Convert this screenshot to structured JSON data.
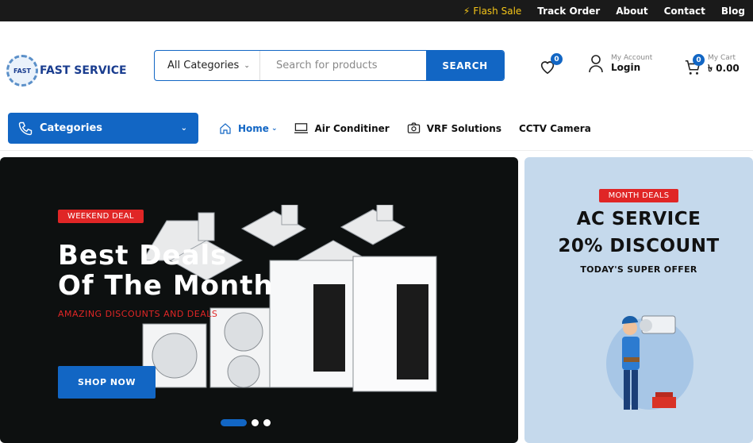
{
  "topbar": {
    "flash_sale": "Flash Sale",
    "track_order": "Track Order",
    "about": "About",
    "contact": "Contact",
    "blog": "Blog"
  },
  "logo": {
    "badge": "FAST",
    "name": "FAST SERVICE"
  },
  "search": {
    "category": "All Categories",
    "placeholder": "Search for products",
    "button": "SEARCH"
  },
  "wishlist": {
    "count": "0"
  },
  "account": {
    "label": "My Account",
    "value": "Login"
  },
  "cart": {
    "label": "My Cart",
    "value": "৳ 0.00",
    "count": "0"
  },
  "categories_button": "Categories",
  "nav": {
    "home": "Home",
    "air": "Air Conditiner",
    "vrf": "VRF Solutions",
    "cctv": "CCTV Camera"
  },
  "hero": {
    "tag": "WEEKEND DEAL",
    "line1": "Best Deals",
    "line2": "Of The Month",
    "sub": "AMAZING DISCOUNTS AND DEALS",
    "button": "SHOP NOW"
  },
  "promo": {
    "tag": "MONTH DEALS",
    "line1": "AC SERVICE",
    "line2": "20% DISCOUNT",
    "line3": "TODAY'S SUPER OFFER"
  },
  "colors": {
    "accent": "#1266c4",
    "deal_red": "#e02626",
    "topbar": "#1a1a1a",
    "flash": "#f5c518"
  }
}
